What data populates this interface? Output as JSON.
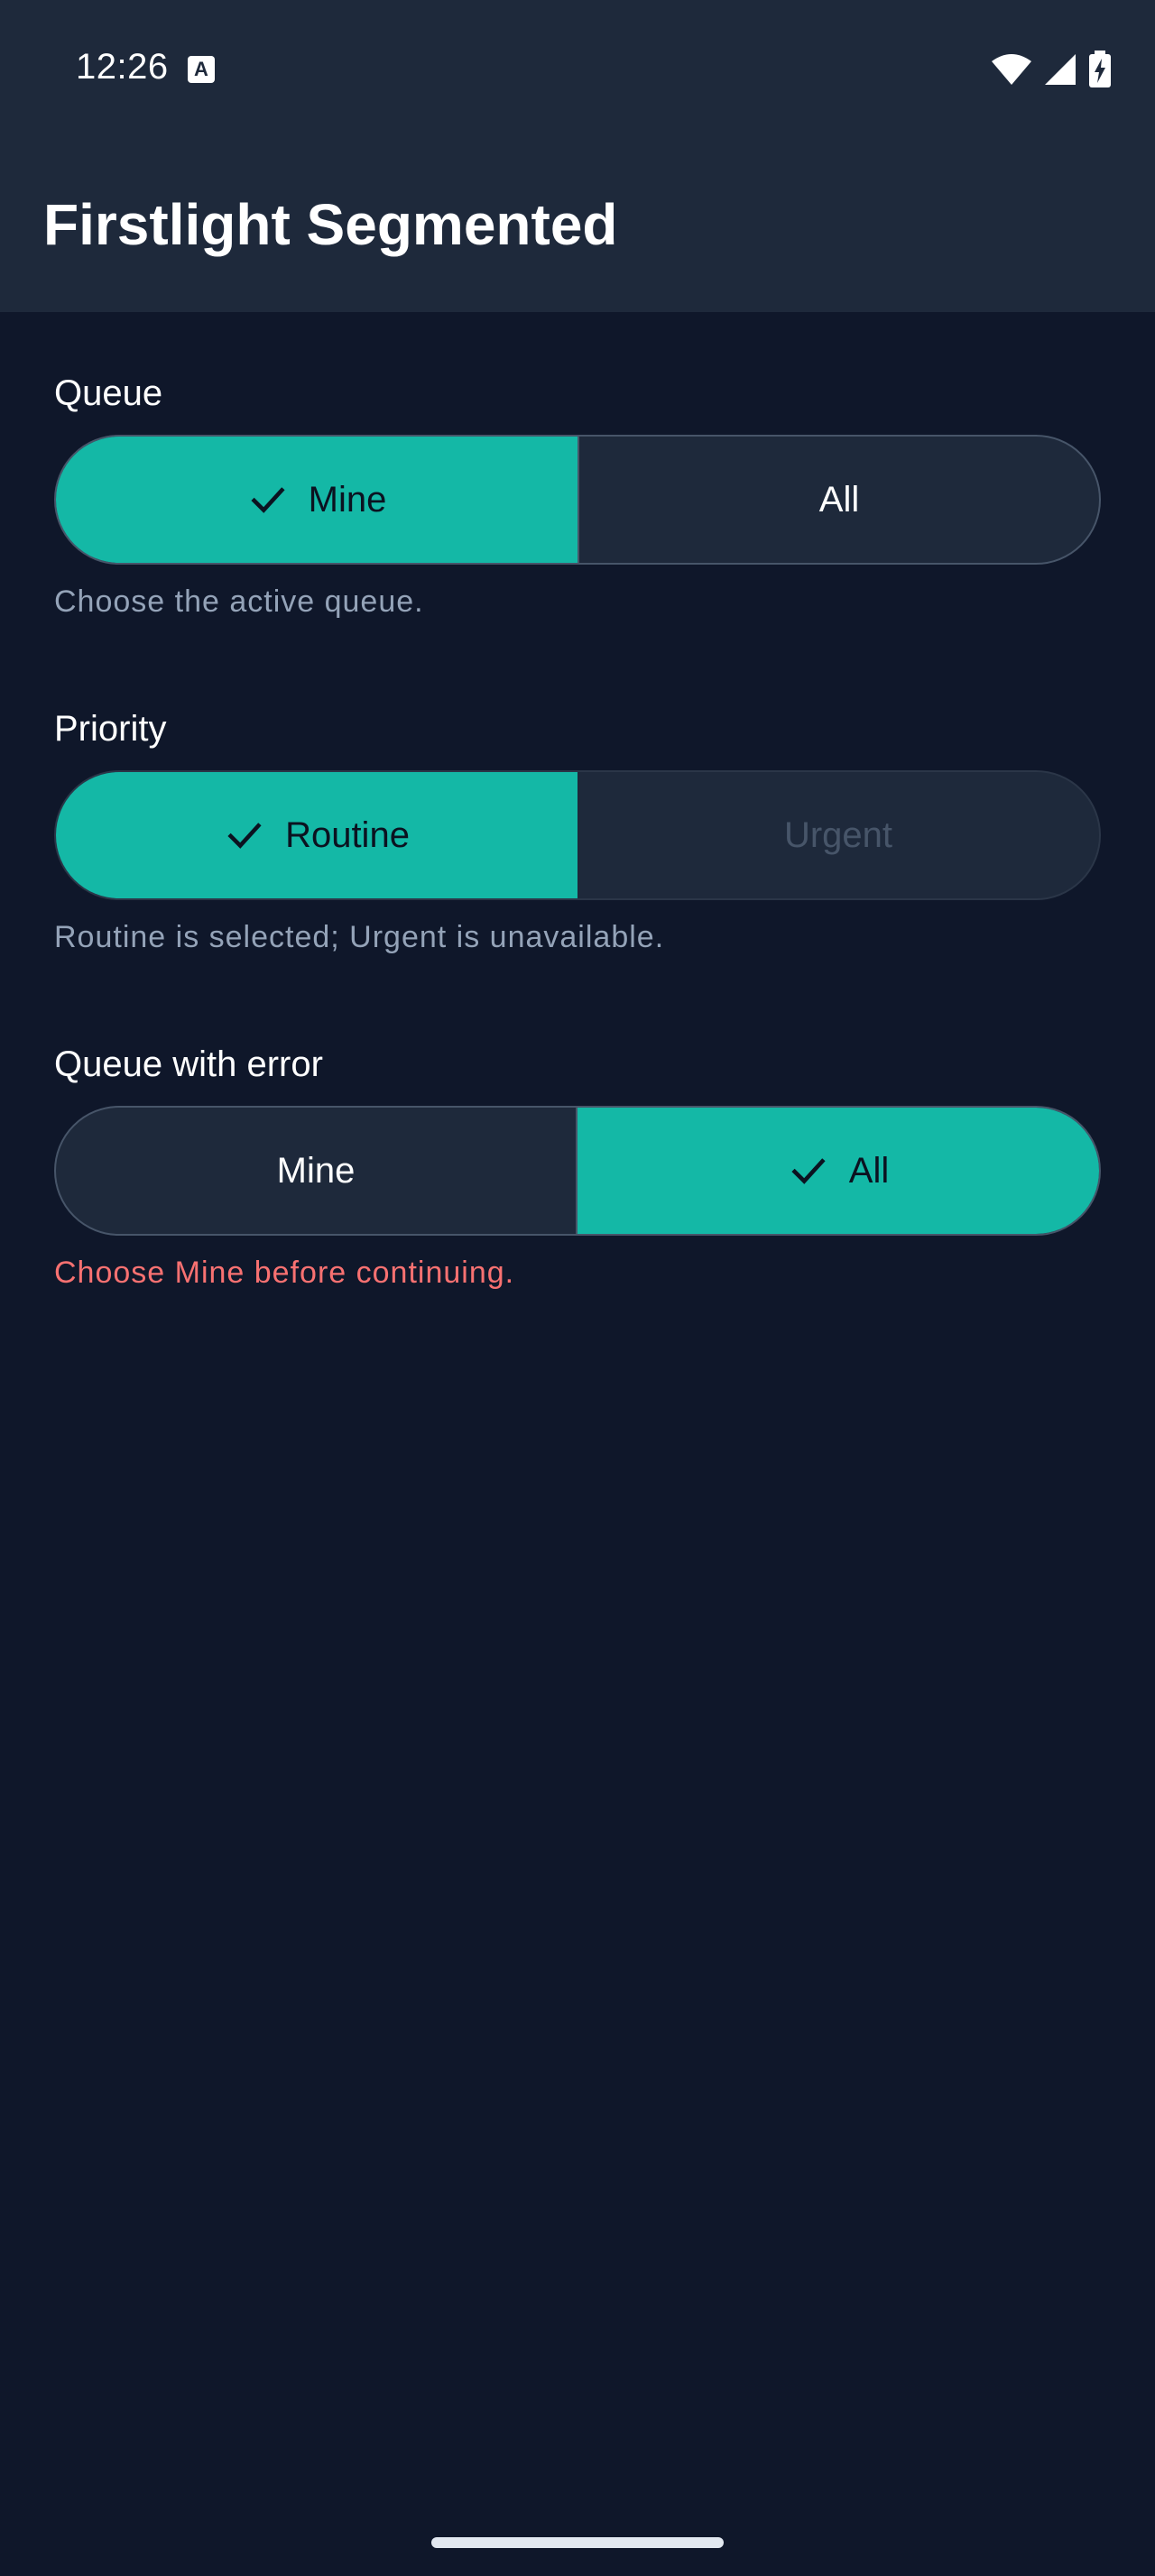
{
  "status_bar": {
    "time": "12:26",
    "notification_icon": "accessibility-a-icon",
    "icons": [
      "wifi-icon",
      "cellular-signal-icon",
      "battery-charging-icon"
    ]
  },
  "app_bar": {
    "title": "Firstlight Segmented"
  },
  "sections": [
    {
      "label": "Queue",
      "options": [
        {
          "label": "Mine",
          "selected": true,
          "disabled": false
        },
        {
          "label": "All",
          "selected": false,
          "disabled": false
        }
      ],
      "supporting_text": "Choose the active queue."
    },
    {
      "label": "Priority",
      "options": [
        {
          "label": "Routine",
          "selected": true,
          "disabled": false
        },
        {
          "label": "Urgent",
          "selected": false,
          "disabled": true
        }
      ],
      "supporting_text": "Routine is selected; Urgent is unavailable."
    },
    {
      "label": "Queue with error",
      "options": [
        {
          "label": "Mine",
          "selected": false,
          "disabled": false
        },
        {
          "label": "All",
          "selected": true,
          "disabled": false
        }
      ],
      "supporting_text": "Choose Mine before continuing.",
      "error": true
    }
  ],
  "colors": {
    "background": "#0f172a",
    "surface": "#1e293b",
    "accent": "#14b8a6",
    "error": "#f87171",
    "muted_text": "#94a3b8"
  }
}
